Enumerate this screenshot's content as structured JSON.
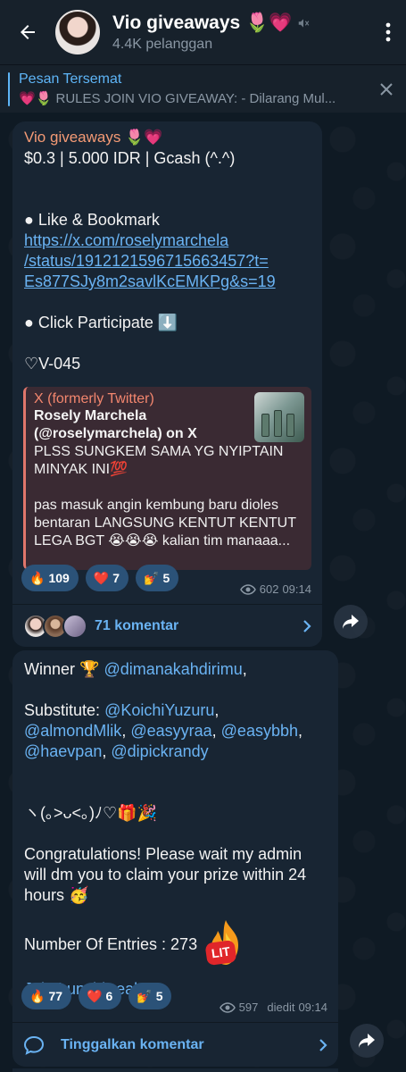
{
  "header": {
    "channel_name": "Vio giveaways 🌷💗",
    "subscribers": "4.4K pelanggan"
  },
  "pinned": {
    "label": "Pesan Tersemat",
    "text": "💗🌷 RULES JOIN VIO GIVEAWAY:  - Dilarang Mul..."
  },
  "post1": {
    "sender": "Vio giveaways 🌷💗",
    "line1": "$0.3 | 5.000 IDR | Gcash (^.^)",
    "like_line": "● Like & Bookmark",
    "link": "https://x.com/roselymarchela/status/1912121596715663457?t=Es877SJy8m2savlKcEMKPg&s=19",
    "link_l1": "https://x.com/roselymarchela",
    "link_l2": "/status/1912121596715663457?t=",
    "link_l3": "Es877SJy8m2savlKcEMKPg&s=19",
    "participate": "● Click Participate ⬇️",
    "code": "♡V-045",
    "preview": {
      "site": "X (formerly Twitter)",
      "title": "Rosely Marchela (@roselymarchela) on X",
      "body1": "PLSS SUNGKEM SAMA YG NYIPTAIN MINYAK INI💯",
      "body2": "pas masuk angin kembung baru dioles bentaran LANGSUNG KENTUT KENTUT LEGA BGT 😭😭😭 kalian tim manaaa..."
    },
    "reactions": [
      {
        "emoji": "🔥",
        "count": "109"
      },
      {
        "emoji": "❤️",
        "count": "7"
      },
      {
        "emoji": "💅",
        "count": "5"
      }
    ],
    "views": "602",
    "time": "09:14",
    "comments_label": "71 komentar"
  },
  "post2": {
    "winner_prefix": "Winner 🏆 ",
    "winner": "@dimanakahdirimu",
    "winner_suffix": ",",
    "sub_prefix": "Substitute: ",
    "subs": [
      "@KoichiYuzuru",
      "@almondMlik",
      "@easyyraa",
      "@easybbh",
      "@haevpan",
      "@dipickrandy"
    ],
    "kaomoji": "ヽ(｡>ᴗ<｡)ﾉ♡🎁🎉",
    "congrats": "Congratulations! Please wait my admin will dm you to claim your prize within 24 hours 🥳",
    "entries_label": "Number Of Entries : 273",
    "lit": "LIT",
    "join": "Join Lunchbreak!",
    "reactions": [
      {
        "emoji": "🔥",
        "count": "77"
      },
      {
        "emoji": "❤️",
        "count": "6"
      },
      {
        "emoji": "💅",
        "count": "5"
      }
    ],
    "views": "597",
    "edited": "diedit",
    "time": "09:14",
    "comment_cta": "Tinggalkan komentar"
  },
  "colors": {
    "accent": "#6ab3f3",
    "bubble": "#182533",
    "header": "#17212b",
    "reaction": "#2b5278"
  }
}
